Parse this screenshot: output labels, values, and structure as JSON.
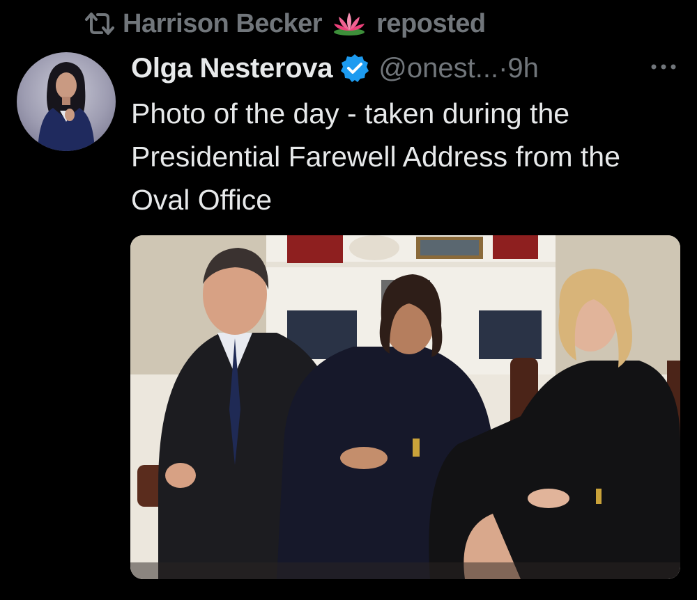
{
  "repost": {
    "reposter": "Harrison Becker",
    "label": "reposted",
    "icon": "repost-icon",
    "emoji": "lotus-icon"
  },
  "author": {
    "name": "Olga Nesterova",
    "handle": "@onest...",
    "time": "·9h",
    "verified_icon": "verified-badge-icon",
    "avatar": "avatar-photo"
  },
  "tweet": {
    "text": "Photo of the day - taken during the Presidential Farewell Address from the Oval Office",
    "more_icon": "more-options-icon"
  },
  "media": {
    "type": "photo"
  },
  "colors": {
    "background": "#000000",
    "text_primary": "#e7e9ea",
    "text_secondary": "#71767b",
    "verified": "#1d9bf0"
  }
}
